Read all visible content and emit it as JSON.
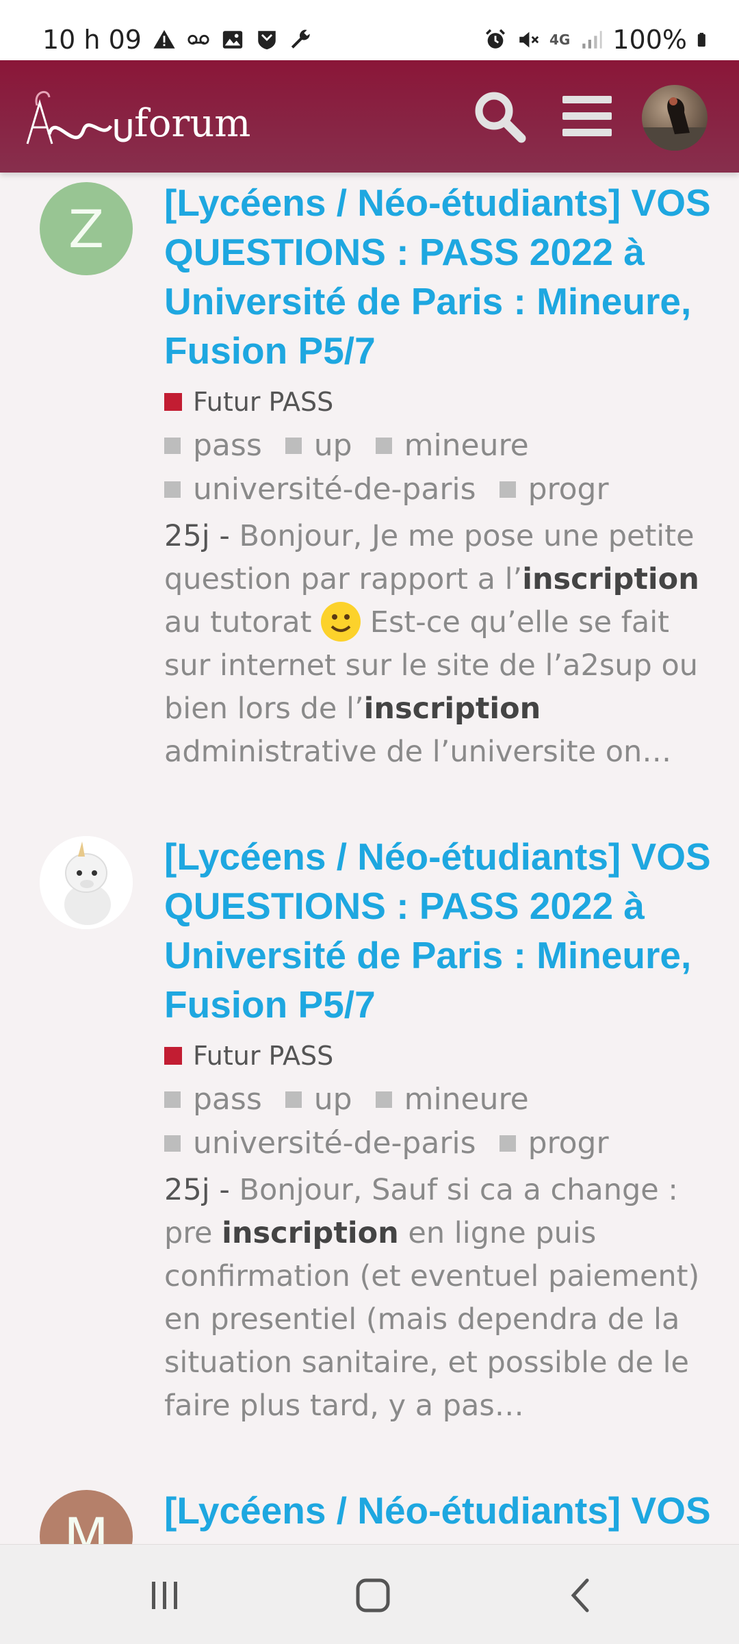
{
  "status_bar": {
    "time": "10 h 09",
    "battery": "100%",
    "network": "4G",
    "left_icons": [
      "warning-icon",
      "voicemail-icon",
      "image-icon",
      "shield-icon",
      "wrench-icon"
    ],
    "right_icons": [
      "alarm-icon",
      "mute-icon",
      "data-icon",
      "signal-icon",
      "battery-icon"
    ]
  },
  "header": {
    "logo_text": "forum",
    "logo_brand": "a2sup",
    "accent": "#8a1638"
  },
  "posts": [
    {
      "avatar_letter": "Z",
      "avatar_color": "#98c593",
      "title": "[Lycéens / Néo-étudiants] VOS QUESTIONS : PASS 2022 à Université de Paris : Mineure, Fusion P5/7",
      "category": "Futur PASS",
      "category_color": "#c21d32",
      "tags": [
        "pass",
        "up",
        "mineure",
        "université-de-paris",
        "progr"
      ],
      "age": "25j",
      "excerpt_parts": [
        "Bonjour, Je me pose une petite question par rapport a l’",
        "inscription",
        " au tutorat ",
        " Est-ce qu’elle se fait sur internet sur le site de l’a2sup ou bien lors de l’",
        "inscription",
        " administrative de l’universite on…"
      ]
    },
    {
      "avatar_letter": "",
      "avatar_color": "#ffffff",
      "title": "[Lycéens / Néo-étudiants] VOS QUESTIONS : PASS 2022 à Université de Paris : Mineure, Fusion P5/7",
      "category": "Futur PASS",
      "category_color": "#c21d32",
      "tags": [
        "pass",
        "up",
        "mineure",
        "université-de-paris",
        "progr"
      ],
      "age": "25j",
      "excerpt_parts": [
        "Bonjour, Sauf si ca a change : pre ",
        "inscription",
        " en ligne puis confirmation (et eventuel paiement) en presentiel (mais dependra de la situation sanitaire, et possible de le faire plus tard, y a pas…"
      ]
    },
    {
      "avatar_letter": "M",
      "avatar_color": "#b5806a",
      "title": "[Lycéens / Néo-étudiants] VOS QUESTIONS : PASS"
    }
  ],
  "nav": {
    "recent": "recent-apps-icon",
    "home": "home-icon",
    "back": "back-icon"
  }
}
